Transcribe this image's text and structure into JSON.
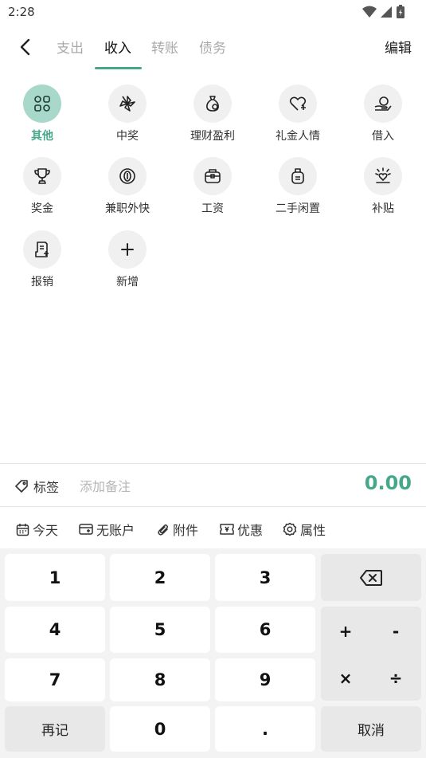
{
  "status_bar": {
    "time": "2:28"
  },
  "nav": {
    "tabs": [
      {
        "label": "支出"
      },
      {
        "label": "收入"
      },
      {
        "label": "转账"
      },
      {
        "label": "债务"
      }
    ],
    "active_tab": "收入",
    "edit_label": "编辑"
  },
  "categories": [
    {
      "label": "其他",
      "icon": "grid-icon",
      "selected": true
    },
    {
      "label": "中奖",
      "icon": "pinwheel-icon"
    },
    {
      "label": "理财盈利",
      "icon": "money-bag-icon"
    },
    {
      "label": "礼金人情",
      "icon": "heart-gift-icon"
    },
    {
      "label": "借入",
      "icon": "hand-coin-icon"
    },
    {
      "label": "奖金",
      "icon": "trophy-icon"
    },
    {
      "label": "兼职外快",
      "icon": "coin-icon"
    },
    {
      "label": "工资",
      "icon": "briefcase-icon"
    },
    {
      "label": "二手闲置",
      "icon": "bag-icon"
    },
    {
      "label": "补贴",
      "icon": "sun-heart-icon"
    },
    {
      "label": "报销",
      "icon": "receipt-icon"
    },
    {
      "label": "新增",
      "icon": "plus-icon"
    }
  ],
  "entry": {
    "tag_label": "标签",
    "note_placeholder": "添加备注",
    "amount": "0.00"
  },
  "options": {
    "date": "今天",
    "account": "无账户",
    "attachment": "附件",
    "discount": "优惠",
    "attribute": "属性"
  },
  "keypad": {
    "digits": [
      "1",
      "2",
      "3",
      "4",
      "5",
      "6",
      "7",
      "8",
      "9",
      "0",
      "."
    ],
    "operators": {
      "plus": "+",
      "minus": "-",
      "multiply": "×",
      "divide": "÷"
    },
    "again_label": "再记",
    "cancel_label": "取消"
  },
  "colors": {
    "accent": "#46a88b",
    "selected_circle": "#a8d8c9"
  }
}
